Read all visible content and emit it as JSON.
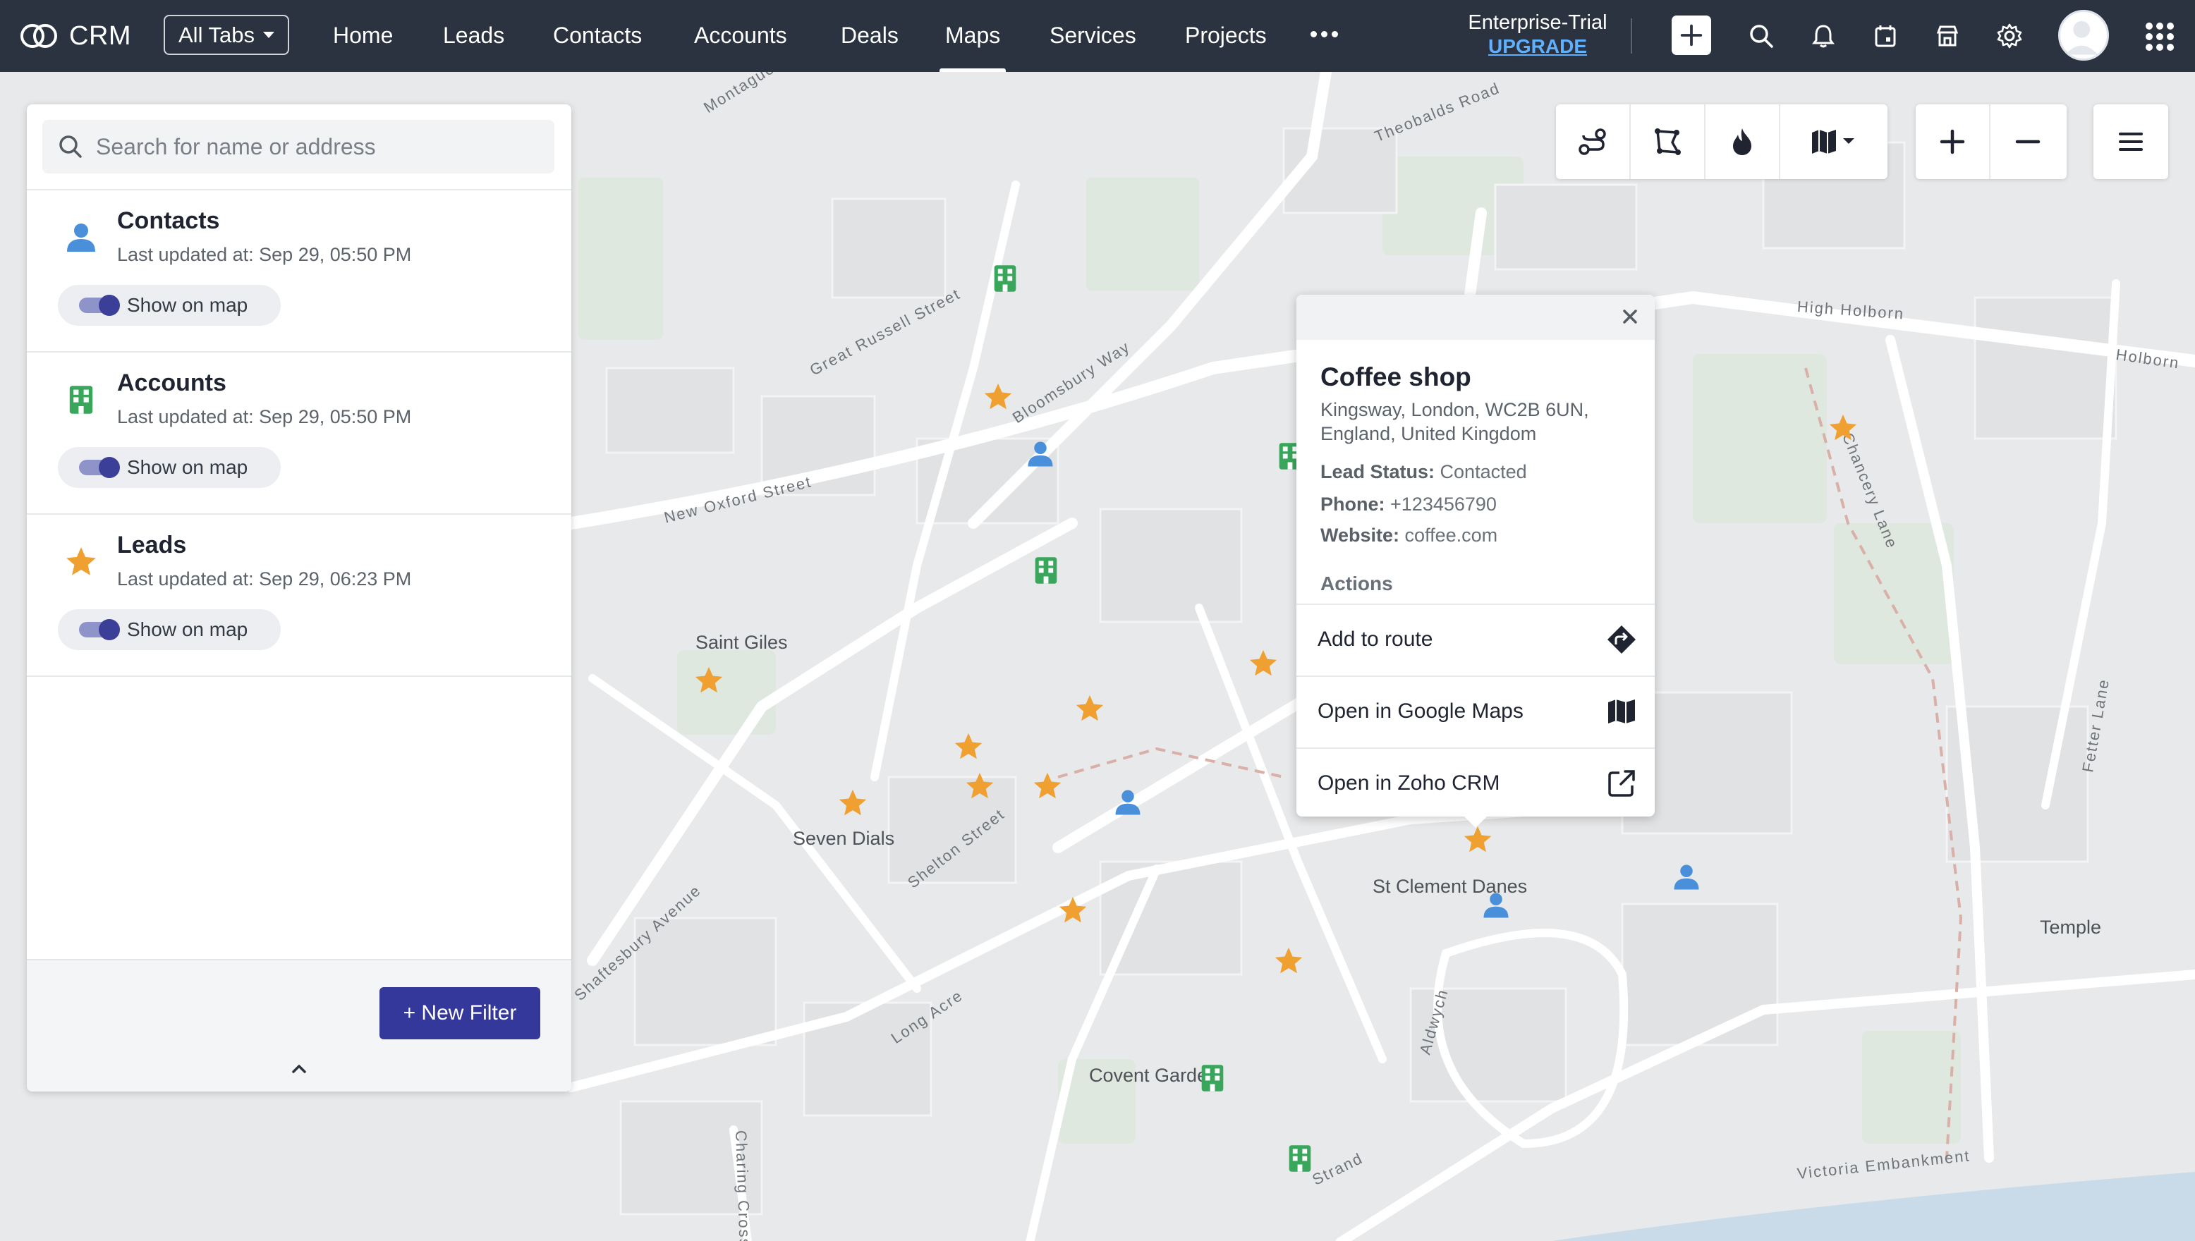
{
  "nav": {
    "logo_text": "CRM",
    "all_tabs_label": "All Tabs",
    "tabs": [
      {
        "label": "Home",
        "active": false
      },
      {
        "label": "Leads",
        "active": false
      },
      {
        "label": "Contacts",
        "active": false
      },
      {
        "label": "Accounts",
        "active": false
      },
      {
        "label": "Deals",
        "active": false
      },
      {
        "label": "Maps",
        "active": true
      },
      {
        "label": "Services",
        "active": false
      },
      {
        "label": "Projects",
        "active": false
      }
    ],
    "more_icon": "more-dots-icon",
    "trial_plan": "Enterprise-Trial",
    "upgrade_label": "UPGRADE",
    "icons": [
      "plus-icon",
      "search-icon",
      "bell-icon",
      "calendar-icon",
      "marketplace-icon",
      "gear-icon",
      "avatar",
      "apps-grid-icon"
    ]
  },
  "sidebar": {
    "search_placeholder": "Search for name or address",
    "layers": [
      {
        "title": "Contacts",
        "updated": "Last updated at: Sep 29, 05:50 PM",
        "toggle_label": "Show on map",
        "toggle_on": true,
        "icon": "contact-person-icon",
        "color": "#4a8fd9"
      },
      {
        "title": "Accounts",
        "updated": "Last updated at: Sep 29, 05:50 PM",
        "toggle_label": "Show on map",
        "toggle_on": true,
        "icon": "building-icon",
        "color": "#3aa65c"
      },
      {
        "title": "Leads",
        "updated": "Last updated at: Sep 29, 06:23 PM",
        "toggle_label": "Show on map",
        "toggle_on": true,
        "icon": "star-icon",
        "color": "#f0a030"
      }
    ],
    "new_filter_label": "+ New Filter",
    "collapse_icon": "chevron-up-icon"
  },
  "map_controls": {
    "group1": [
      "route-icon",
      "lasso-polygon-icon",
      "heatmap-flame-icon",
      "map-style-dropdown-icon"
    ],
    "zoom_in": "plus-icon",
    "zoom_out": "minus-icon",
    "menu": "hamburger-menu-icon"
  },
  "map": {
    "streets": [
      "Montague Street",
      "Great Russell Street",
      "Bloomsbury Way",
      "New Oxford Street",
      "Theobalds Road",
      "High Holborn",
      "Holborn",
      "Chancery Lane",
      "Fetter Lane",
      "Shaftesbury Avenue",
      "Shelton Street",
      "Long Acre",
      "Aldwych",
      "Strand",
      "Victoria Embankment",
      "Charing Cross"
    ],
    "places": [
      "Saint Giles",
      "Seven Dials",
      "St Clement Danes",
      "Temple",
      "Covent Garden"
    ]
  },
  "popup": {
    "title": "Coffee shop",
    "address": "Kingsway, London, WC2B 6UN, England, United Kingdom",
    "lead_status_label": "Lead Status:",
    "lead_status": "Contacted",
    "phone_label": "Phone:",
    "phone": "+123456790",
    "website_label": "Website:",
    "website": "coffee.com",
    "actions_title": "Actions",
    "actions": [
      {
        "label": "Add to route",
        "icon": "directions-icon"
      },
      {
        "label": "Open in Google Maps",
        "icon": "map-icon"
      },
      {
        "label": "Open in Zoho CRM",
        "icon": "external-link-icon"
      }
    ]
  },
  "colors": {
    "nav_bg": "#2b3240",
    "accent": "#33389a",
    "lead_star": "#f0a030",
    "contact_blue": "#4a8fd9",
    "account_green": "#3aa65c",
    "upgrade_link": "#5fb0ff"
  }
}
